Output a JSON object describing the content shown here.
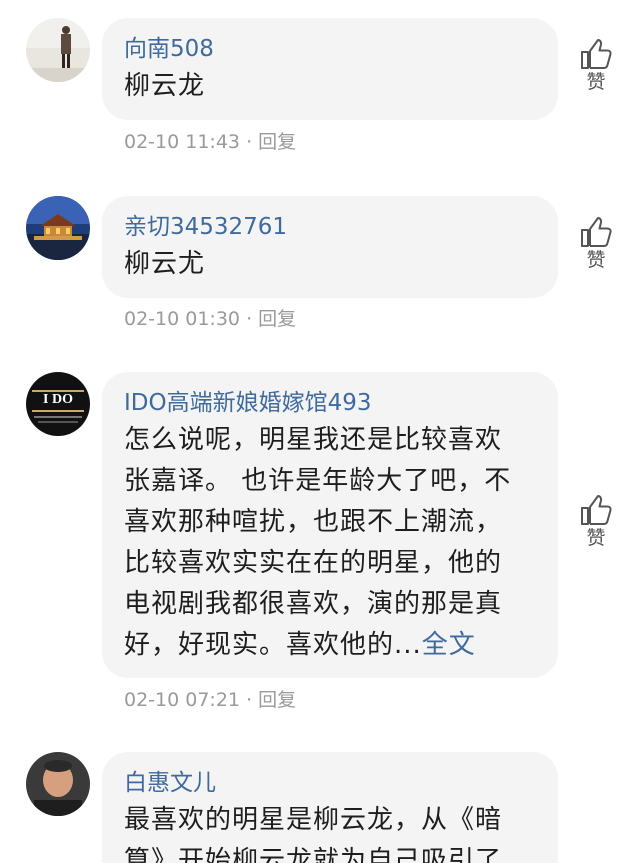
{
  "comments": [
    {
      "username": "向南508",
      "lines": [
        "柳云龙"
      ],
      "more": "",
      "date": "02-10 11:43",
      "separator": "·",
      "reply": "回复",
      "like": "赞"
    },
    {
      "username": "亲切34532761",
      "lines": [
        "柳云尤"
      ],
      "more": "",
      "date": "02-10 01:30",
      "separator": "·",
      "reply": "回复",
      "like": "赞"
    },
    {
      "username": "IDO高端新娘婚嫁馆493",
      "lines": [
        "怎么说呢，明星我还是比较喜欢",
        "张嘉译。 也许是年龄大了吧，不",
        "喜欢那种喧扰，也跟不上潮流，",
        "比较喜欢实实在在的明星，他的",
        "电视剧我都很喜欢，演的那是真",
        "好，好现实。喜欢他的..."
      ],
      "more": "全文",
      "date": "02-10 07:21",
      "separator": "·",
      "reply": "回复",
      "like": "赞",
      "avatar_logo": "I DO"
    },
    {
      "username": "白惠文儿",
      "lines": [
        "最喜欢的明星是柳云龙，从《暗",
        "算》开始柳云龙就为自己吸引了"
      ],
      "more": "",
      "date": "",
      "separator": "",
      "reply": "",
      "like": ""
    }
  ]
}
